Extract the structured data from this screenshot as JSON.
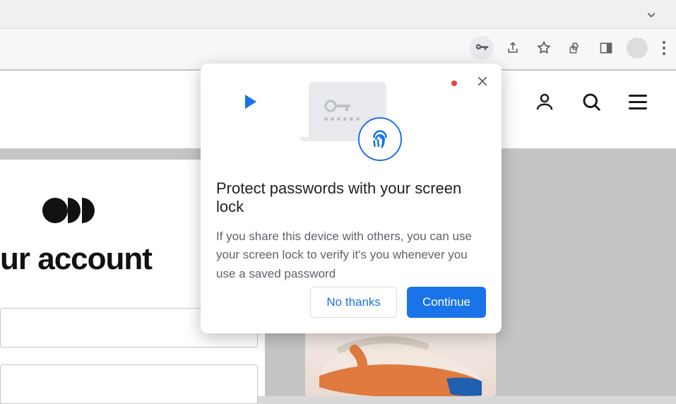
{
  "toolbar": {
    "icons": {
      "key": "key-icon",
      "share": "share-icon",
      "star": "star-icon",
      "extensions": "extensions-icon",
      "sidepanel": "sidepanel-icon",
      "avatar": "avatar",
      "menu": "menu-icon"
    }
  },
  "page": {
    "heading_visible": "ur account",
    "site_nav": {
      "account": "account-icon",
      "search": "search-icon",
      "menu": "menu-icon"
    }
  },
  "dialog": {
    "title": "Protect passwords with your screen lock",
    "body": "If you share this device with others, you can use your screen lock to verify it's you whenever you use a saved password",
    "actions": {
      "secondary": "No thanks",
      "primary": "Continue"
    }
  }
}
